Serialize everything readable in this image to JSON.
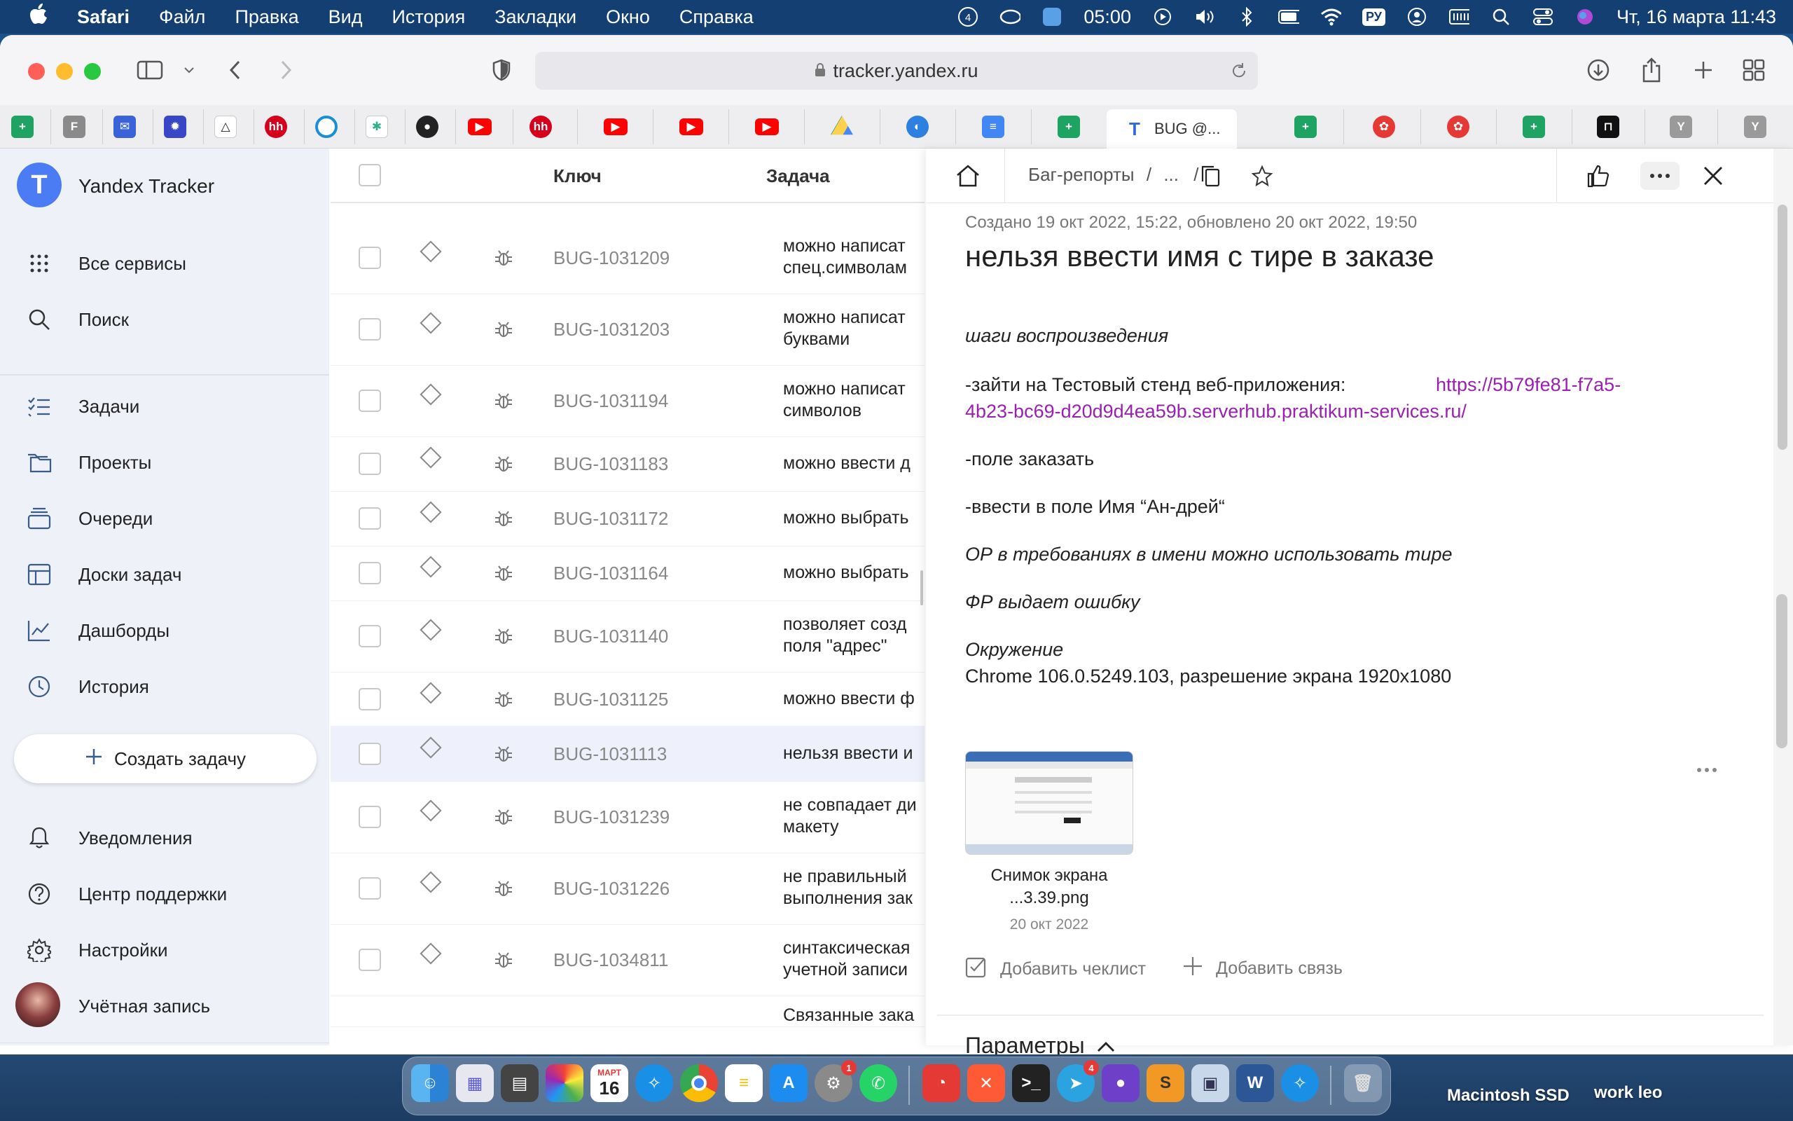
{
  "menubar": {
    "app": "Safari",
    "items": [
      "Файл",
      "Правка",
      "Вид",
      "История",
      "Закладки",
      "Окно",
      "Справка"
    ],
    "notif_count": "4",
    "time_timer": "05:00",
    "lang": "РУ",
    "datetime": "Чт, 16 марта  11:43"
  },
  "browser": {
    "url": "tracker.yandex.ru",
    "active_tab": "BUG @..."
  },
  "sidebar": {
    "app_name": "Yandex Tracker",
    "top_items": [
      {
        "label": "Все сервисы",
        "icon": "grid-icon"
      },
      {
        "label": "Поиск",
        "icon": "search-icon"
      }
    ],
    "nav_items": [
      {
        "label": "Задачи",
        "icon": "tasks-icon"
      },
      {
        "label": "Проекты",
        "icon": "projects-icon"
      },
      {
        "label": "Очереди",
        "icon": "queues-icon"
      },
      {
        "label": "Доски задач",
        "icon": "boards-icon"
      },
      {
        "label": "Дашборды",
        "icon": "dashboards-icon"
      },
      {
        "label": "История",
        "icon": "history-icon"
      }
    ],
    "create_label": "Создать задачу",
    "bottom_items": [
      {
        "label": "Уведомления",
        "icon": "bell-icon"
      },
      {
        "label": "Центр поддержки",
        "icon": "help-icon"
      },
      {
        "label": "Настройки",
        "icon": "gear-icon"
      },
      {
        "label": "Учётная запись",
        "icon": "avatar"
      }
    ]
  },
  "task_list": {
    "col_key": "Ключ",
    "col_task": "Задача",
    "rows": [
      {
        "key": "BUG-1031209",
        "task1": "можно написат",
        "task2": "спец.символам"
      },
      {
        "key": "BUG-1031203",
        "task1": "можно написат",
        "task2": "буквами"
      },
      {
        "key": "BUG-1031194",
        "task1": "можно написат",
        "task2": "символов"
      },
      {
        "key": "BUG-1031183",
        "task1": "можно ввести д",
        "task2": ""
      },
      {
        "key": "BUG-1031172",
        "task1": "можно выбрать",
        "task2": ""
      },
      {
        "key": "BUG-1031164",
        "task1": "можно выбрать",
        "task2": ""
      },
      {
        "key": "BUG-1031140",
        "task1": "позволяет созд",
        "task2": "поля \"адрес\""
      },
      {
        "key": "BUG-1031125",
        "task1": "можно ввести ф",
        "task2": ""
      },
      {
        "key": "BUG-1031113",
        "task1": "нельзя ввести и",
        "task2": ""
      },
      {
        "key": "BUG-1031239",
        "task1": "не совпадает ди",
        "task2": "макету"
      },
      {
        "key": "BUG-1031226",
        "task1": "не правильный",
        "task2": "выполнения зак"
      },
      {
        "key": "BUG-1034811",
        "task1": "синтаксическая",
        "task2": "учетной записи"
      }
    ],
    "partial_row": "Связанные зака"
  },
  "detail": {
    "breadcrumb": "Баг-репорты",
    "breadcrumb_sep": "/",
    "breadcrumb_more": "...",
    "meta": "Создано 19 окт 2022, 15:22, обновлено 20 окт 2022, 19:50",
    "title": "нельзя ввести имя с тире в заказе",
    "steps_heading": "шаги воспроизведения",
    "step1_text": "-зайти на Тестовый стенд веб-приложения:",
    "step1_link_a": "https://5b79fe81-f7a5-",
    "step1_link_b": "4b23-bc69-d20d9d4ea59b.serverhub.praktikum-services.ru/",
    "step2": "-поле заказать",
    "step3": "-ввести в поле Имя “Ан-дрей“",
    "expected": "ОР в требованиях в имени можно использовать тире",
    "actual": "ФР выдает ошибку",
    "env_heading": "Окружение",
    "env_value": "Chrome 106.0.5249.103, разрешение экрана 1920x1080",
    "attachment_name1": "Снимок экрана",
    "attachment_name2": "...3.39.png",
    "attachment_date": "20 окт 2022",
    "add_checklist": "Добавить чеклист",
    "add_link": "Добавить связь",
    "params": "Параметры"
  },
  "dock": {
    "calendar_month": "МАРТ",
    "calendar_day": "16",
    "settings_badge": "1",
    "telegram_badge": "4"
  },
  "desktop": {
    "disk_label": "Macintosh SSD",
    "folder_label": "work leo"
  },
  "colors": {
    "accent": "#4c7cf3",
    "link": "#9b1fb3",
    "sidebar_bg": "#eef1f8",
    "selected_row": "#eef1fb"
  }
}
